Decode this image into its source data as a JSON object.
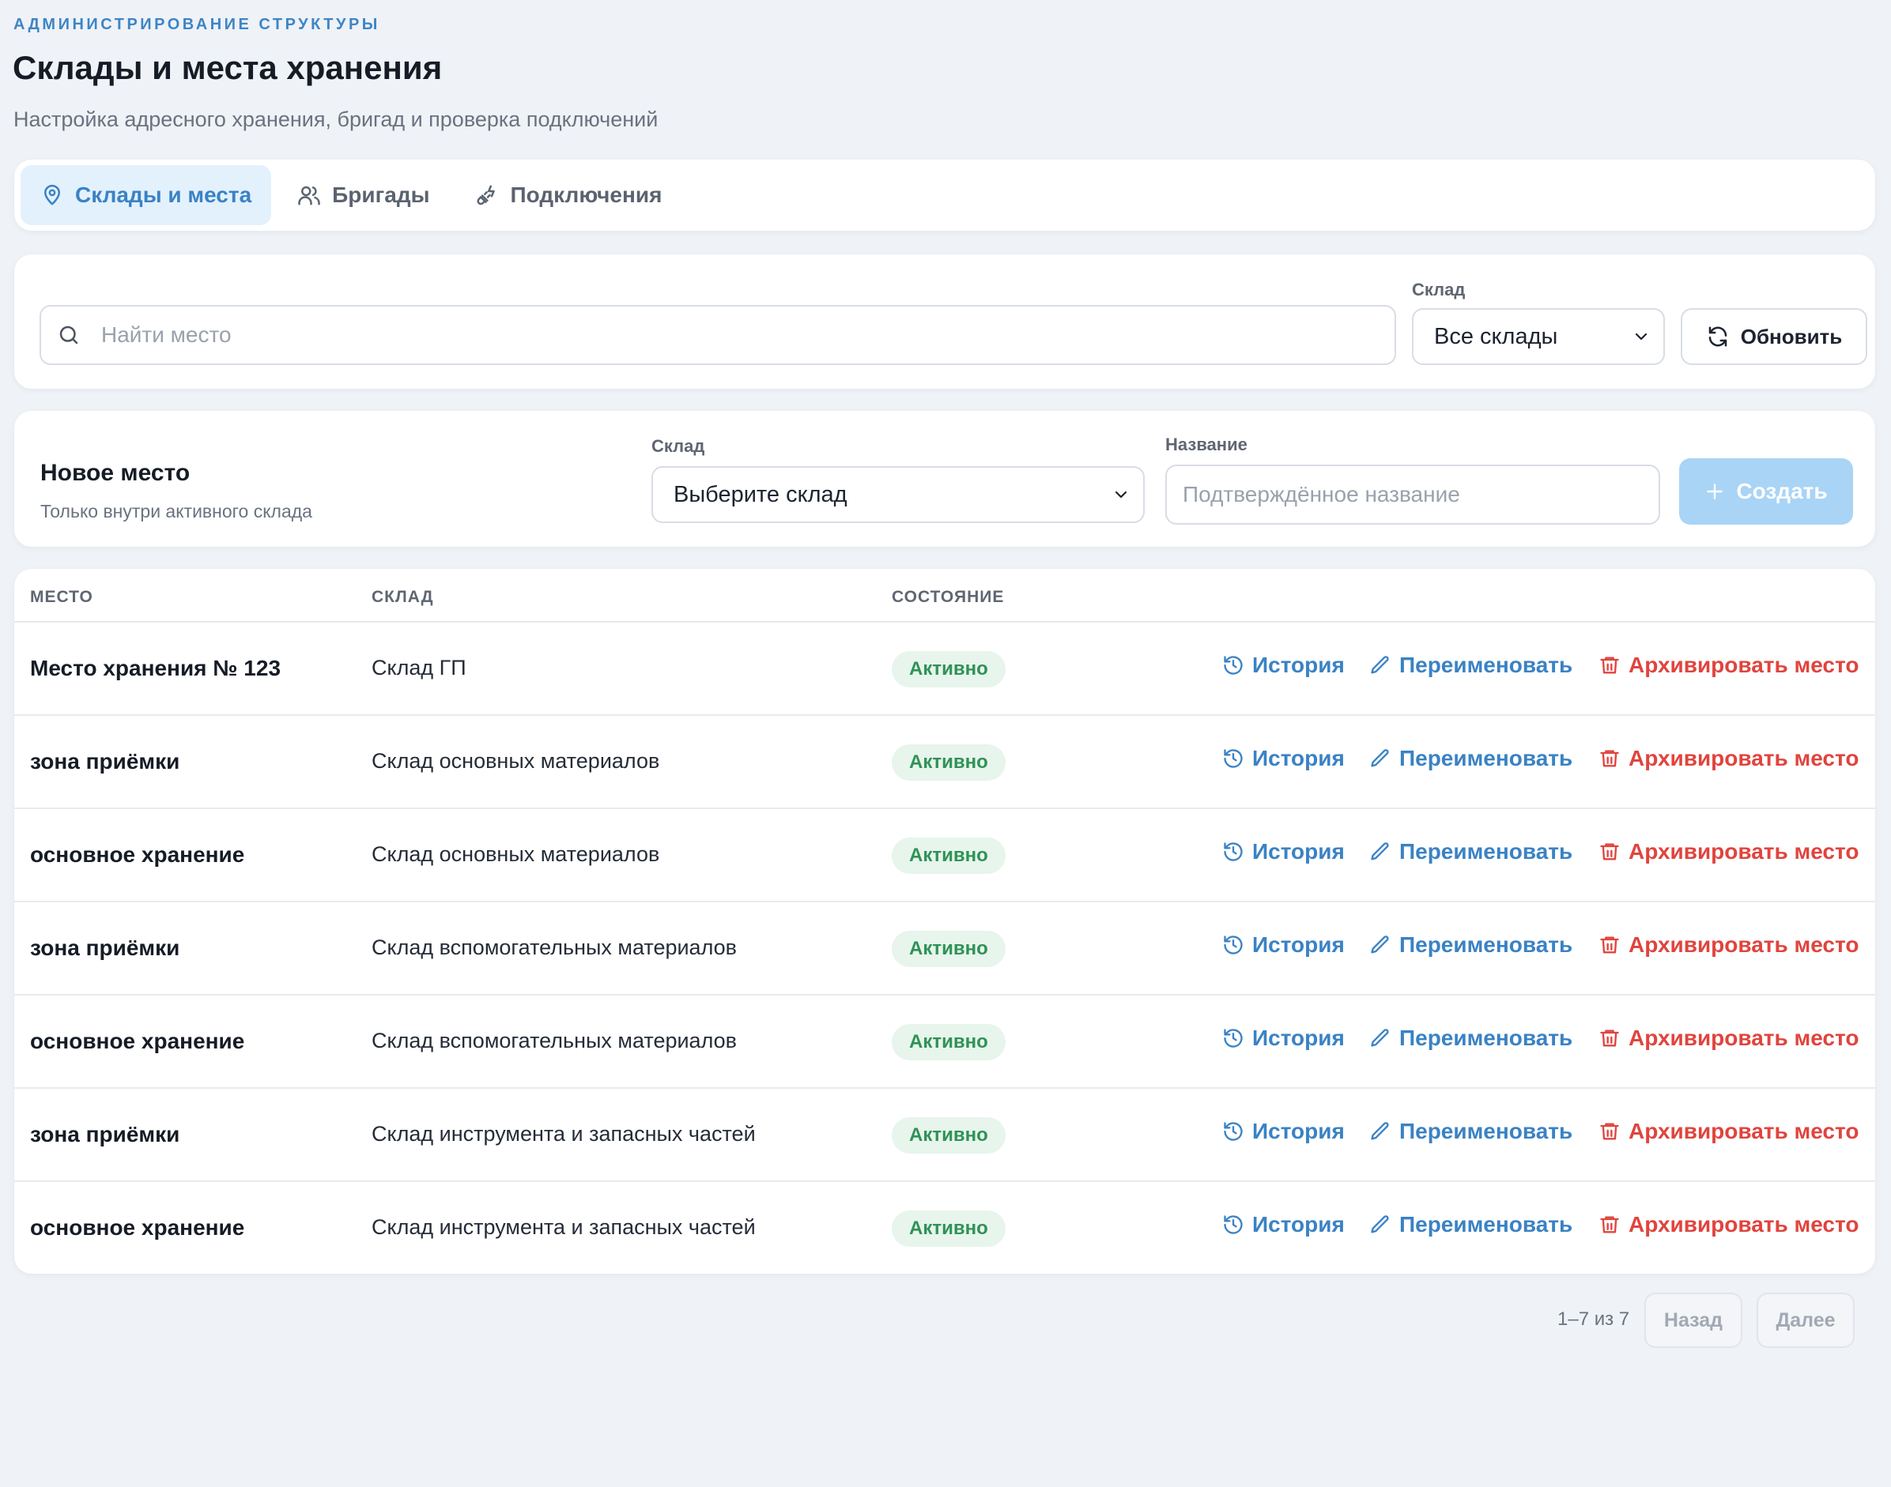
{
  "header": {
    "eyebrow": "АДМИНИСТРИРОВАНИЕ СТРУКТУРЫ",
    "title": "Склады и места хранения",
    "subtitle": "Настройка адресного хранения, бригад и проверка подключений"
  },
  "tabs": [
    {
      "label": "Склады и места",
      "icon": "map-pin-icon",
      "active": true
    },
    {
      "label": "Бригады",
      "icon": "users-icon",
      "active": false
    },
    {
      "label": "Подключения",
      "icon": "plug-icon",
      "active": false
    }
  ],
  "filters": {
    "search_placeholder": "Найти место",
    "warehouse_label": "Склад",
    "warehouse_value": "Все склады",
    "refresh_label": "Обновить"
  },
  "new_place": {
    "title": "Новое место",
    "subtitle": "Только внутри активного склада",
    "warehouse_label": "Склад",
    "warehouse_value": "Выберите склад",
    "name_label": "Название",
    "name_placeholder": "Подтверждённое название",
    "create_label": "Создать"
  },
  "table": {
    "columns": [
      "МЕСТО",
      "СКЛАД",
      "СОСТОЯНИЕ"
    ],
    "actions": {
      "history": "История",
      "rename": "Переименовать",
      "archive": "Архивировать место"
    },
    "rows": [
      {
        "place": "Место хранения № 123",
        "warehouse": "Склад ГП",
        "status": "Активно"
      },
      {
        "place": "зона приёмки",
        "warehouse": "Склад основных материалов",
        "status": "Активно"
      },
      {
        "place": "основное хранение",
        "warehouse": "Склад основных материалов",
        "status": "Активно"
      },
      {
        "place": "зона приёмки",
        "warehouse": "Склад вспомогательных материалов",
        "status": "Активно"
      },
      {
        "place": "основное хранение",
        "warehouse": "Склад вспомогательных материалов",
        "status": "Активно"
      },
      {
        "place": "зона приёмки",
        "warehouse": "Склад инструмента и запасных частей",
        "status": "Активно"
      },
      {
        "place": "основное хранение",
        "warehouse": "Склад инструмента и запасных частей",
        "status": "Активно"
      }
    ]
  },
  "pagination": {
    "info": "1–7 из 7",
    "prev_label": "Назад",
    "next_label": "Далее"
  },
  "colors": {
    "accent": "#3a82c4",
    "danger": "#e0443e",
    "success": "#2f9256",
    "background": "#eff2f7"
  }
}
